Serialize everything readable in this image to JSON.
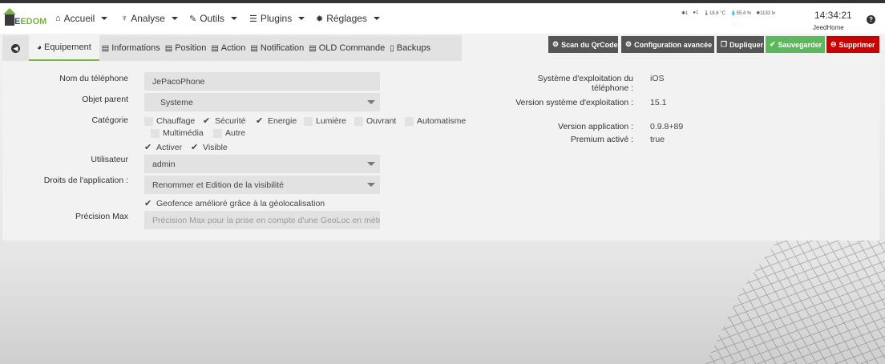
{
  "nav": {
    "logo": "JEEDOM",
    "menu": [
      {
        "label": "Accueil",
        "icon": "home-icon",
        "glyph": "⌂"
      },
      {
        "label": "Analyse",
        "icon": "stethoscope-icon",
        "glyph": "♆"
      },
      {
        "label": "Outils",
        "icon": "wrench-icon",
        "glyph": "✎"
      },
      {
        "label": "Plugins",
        "icon": "list-icon",
        "glyph": "☰"
      },
      {
        "label": "Réglages",
        "icon": "gear-icon",
        "glyph": "✹"
      }
    ],
    "weather": [
      "1",
      "1",
      "18.6 °C",
      "55.4 %",
      "1132 lx"
    ],
    "time": "14:34:21",
    "host": "JeedHome"
  },
  "tabs": [
    "Equipement",
    "Informations",
    "Position",
    "Action",
    "Notification",
    "OLD Commande",
    "Backups"
  ],
  "buttons": {
    "scan": "Scan du QrCode",
    "config": "Configuration avancée",
    "dup": "Dupliquer",
    "save": "Sauvegarder",
    "delete": "Supprimer"
  },
  "form": {
    "name_label": "Nom du téléphone",
    "name": "JePacoPhone",
    "parent_label": "Objet parent",
    "parent": "Systeme",
    "cat_label": "Catégorie",
    "categories": [
      {
        "label": "Chauffage",
        "checked": false
      },
      {
        "label": "Sécurité",
        "checked": true
      },
      {
        "label": "Energie",
        "checked": true
      },
      {
        "label": "Lumière",
        "checked": false
      },
      {
        "label": "Ouvrant",
        "checked": false
      },
      {
        "label": "Automatisme",
        "checked": false
      },
      {
        "label": "Multimédia",
        "checked": false
      },
      {
        "label": "Autre",
        "checked": false
      }
    ],
    "activate": "Activer",
    "visible": "Visible",
    "user_label": "Utilisateur",
    "user": "admin",
    "rights_label": "Droits de l'application :",
    "rights": "Renommer et Edition de la visibilité",
    "geofence": "Geofence amélioré grâce à la géolocalisation",
    "precision_label": "Précision Max",
    "precision_placeholder": "Précision Max pour la prise en compte d'une GeoLoc en mètres"
  },
  "info": {
    "os_label": "Système d'exploitation du téléphone :",
    "os": "iOS",
    "osver_label": "Version système d'exploitation :",
    "osver": "15.1",
    "appver_label": "Version application :",
    "appver": "0.9.8+89",
    "premium_label": "Premium activé :",
    "premium": "true"
  }
}
